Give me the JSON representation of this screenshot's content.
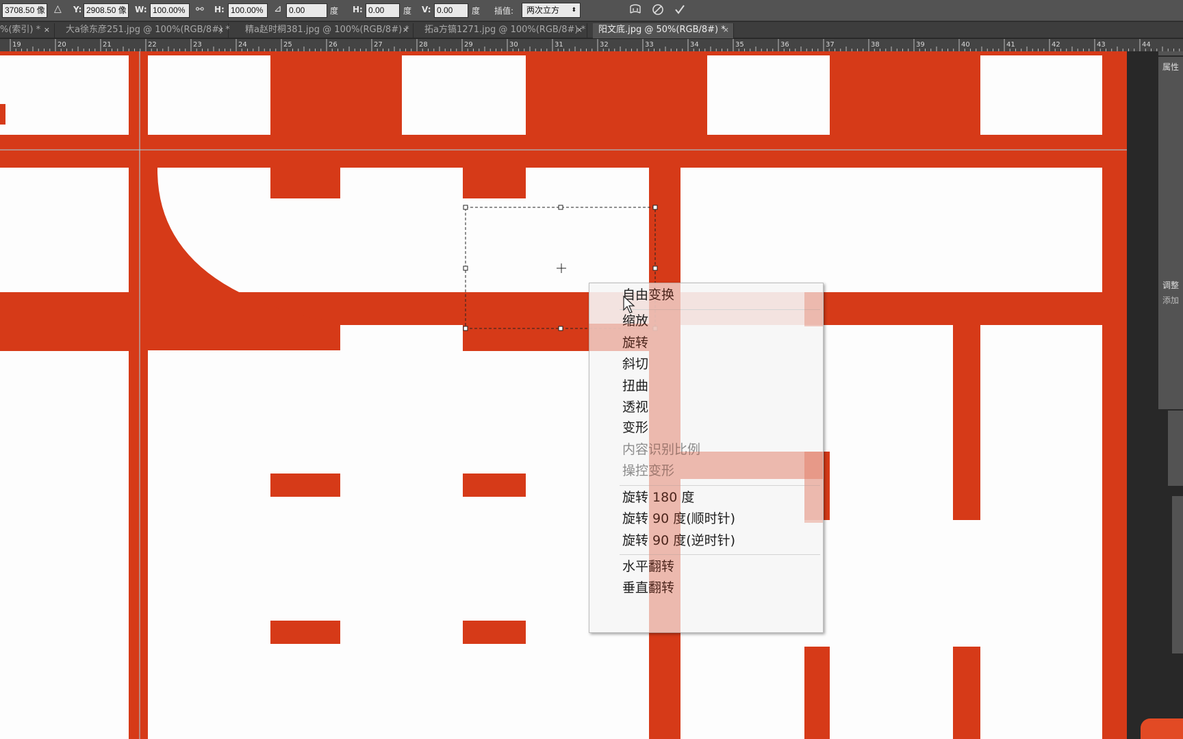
{
  "options_bar": {
    "x_value": "3708.50 像",
    "y_label": "Y:",
    "y_value": "2908.50 像",
    "w_label": "W:",
    "w_value": "100.00%",
    "h_label": "H:",
    "h_value": "100.00%",
    "angle_value": "0.00",
    "angle_unit": "度",
    "hskew_label": "H:",
    "hskew_value": "0.00",
    "hskew_unit": "度",
    "vskew_label": "V:",
    "vskew_value": "0.00",
    "vskew_unit": "度",
    "interp_label": "插值:",
    "interp_value": "两次立方"
  },
  "tabs": [
    {
      "label": "%(索引) *",
      "active": false
    },
    {
      "label": "大a徐东彦251.jpg @ 100%(RGB/8#) *",
      "active": false
    },
    {
      "label": "精a赵时桐381.jpg @ 100%(RGB/8#) *",
      "active": false
    },
    {
      "label": "拓a方镐1271.jpg @ 100%(RGB/8#) *",
      "active": false
    },
    {
      "label": "阳文底.jpg @ 50%(RGB/8#) *",
      "active": true
    }
  ],
  "tab_close": "×",
  "ruler": {
    "labels": [
      "19",
      "20",
      "21",
      "22",
      "23",
      "24",
      "25",
      "26",
      "27",
      "28",
      "29",
      "30",
      "31",
      "32",
      "33",
      "34",
      "35",
      "36",
      "37",
      "38",
      "39",
      "40",
      "41",
      "42",
      "43",
      "44"
    ]
  },
  "colors": {
    "seal_red": "#d63a18",
    "canvas_bg": "#fdfdfd",
    "menu_bg": "#f5f5f5"
  },
  "context_menu": {
    "items": [
      {
        "label": "自由变换",
        "disabled": false
      },
      {
        "label": "缩放",
        "disabled": false
      },
      {
        "label": "旋转",
        "disabled": false
      },
      {
        "label": "斜切",
        "disabled": false
      },
      {
        "label": "扭曲",
        "disabled": false
      },
      {
        "label": "透视",
        "disabled": false
      },
      {
        "label": "变形",
        "disabled": false
      },
      {
        "label": "内容识别比例",
        "disabled": true
      },
      {
        "label": "操控变形",
        "disabled": true
      },
      {
        "label": "旋转 180 度",
        "disabled": false
      },
      {
        "label": "旋转 90 度(顺时针)",
        "disabled": false
      },
      {
        "label": "旋转 90 度(逆时针)",
        "disabled": false
      },
      {
        "label": "水平翻转",
        "disabled": false
      },
      {
        "label": "垂直翻转",
        "disabled": false
      }
    ]
  },
  "panel": {
    "properties_label": "属性",
    "adjust_label": "调整",
    "add_label": "添加"
  }
}
